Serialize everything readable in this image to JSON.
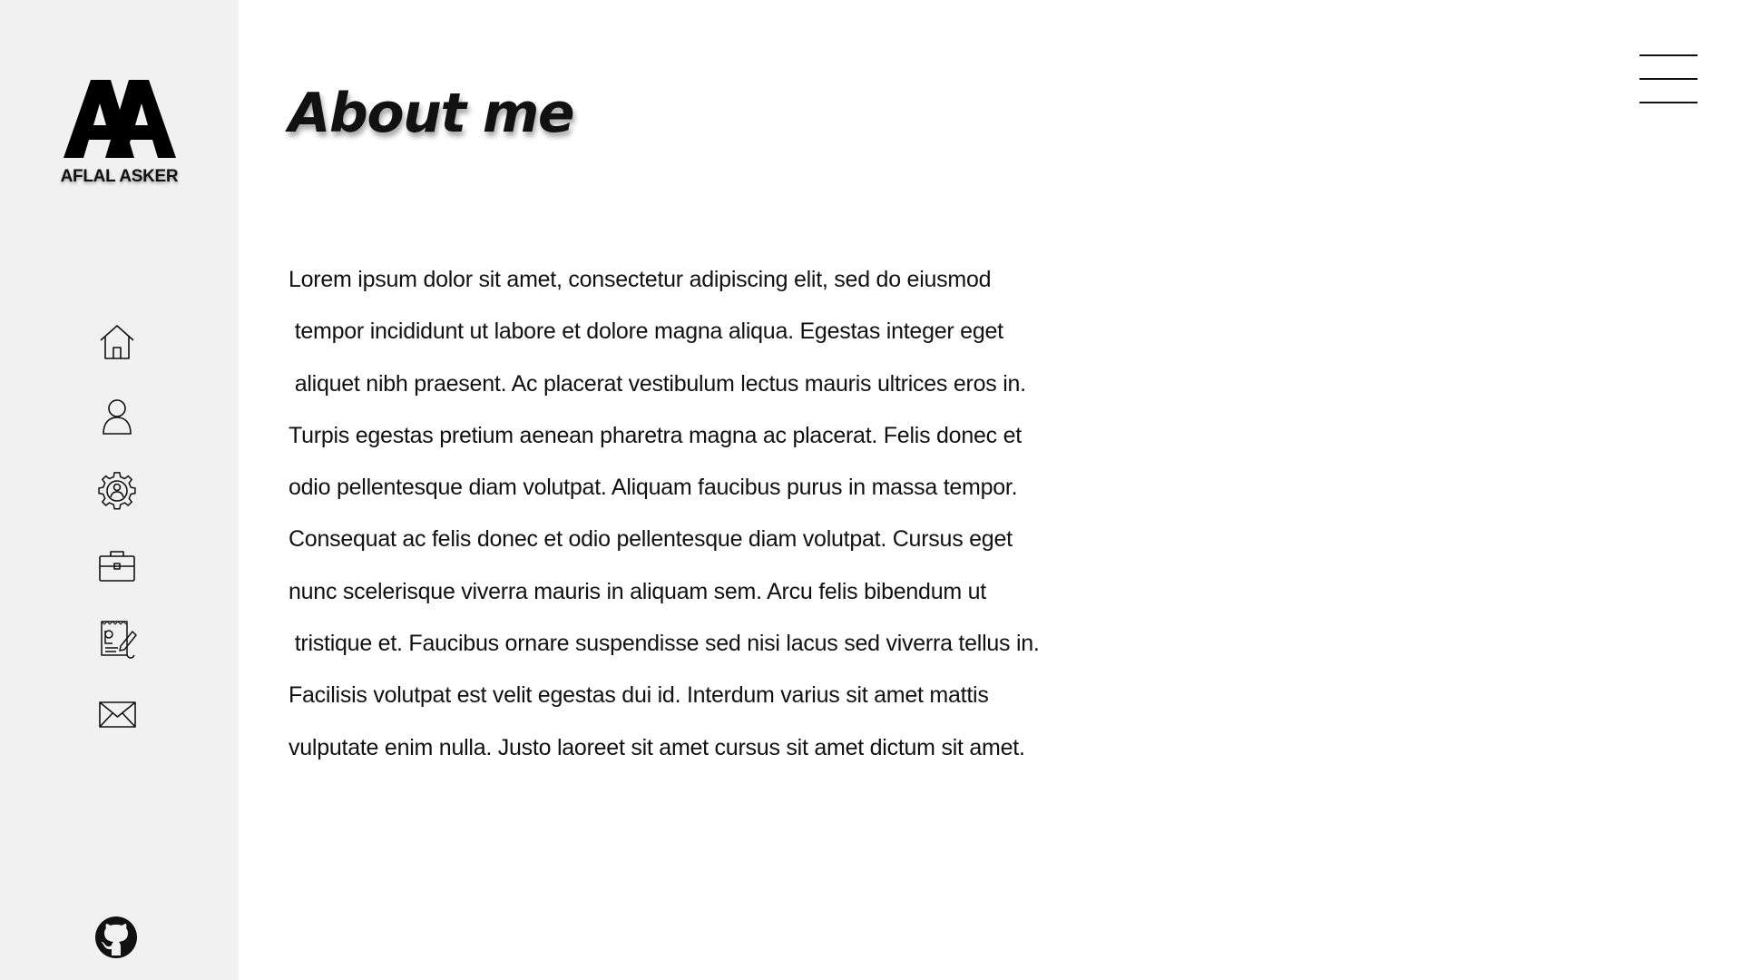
{
  "sidebar": {
    "logo_monogram": "AA",
    "logo_name": "AFLAL ASKER",
    "nav_items": [
      {
        "icon": "home-icon"
      },
      {
        "icon": "user-icon"
      },
      {
        "icon": "skills-gear-icon"
      },
      {
        "icon": "briefcase-icon"
      },
      {
        "icon": "resume-edit-icon"
      },
      {
        "icon": "mail-icon"
      }
    ],
    "footer_icon": "github-icon"
  },
  "header": {
    "menu_icon": "hamburger-menu-icon"
  },
  "main": {
    "title": "About me",
    "paragraph_lines": [
      "Lorem ipsum dolor sit amet, consectetur adipiscing elit, sed do eiusmod",
      " tempor incididunt ut labore et dolore magna aliqua. Egestas integer eget",
      " aliquet nibh praesent. Ac placerat vestibulum lectus mauris ultrices eros in.",
      "Turpis egestas pretium aenean pharetra magna ac placerat. Felis donec et",
      "odio pellentesque diam volutpat. Aliquam faucibus purus in massa tempor.",
      "Consequat ac felis donec et odio pellentesque diam volutpat. Cursus eget",
      "nunc scelerisque viverra mauris in aliquam sem. Arcu felis bibendum ut",
      " tristique et. Faucibus ornare suspendisse sed nisi lacus sed viverra tellus in.",
      "Facilisis volutpat est velit egestas dui id. Interdum varius sit amet mattis",
      "vulputate enim nulla. Justo laoreet sit amet cursus sit amet dictum sit amet."
    ]
  },
  "colors": {
    "sidebar_background": "#f1f1f1",
    "page_background": "#ffffff",
    "text": "#111111"
  }
}
